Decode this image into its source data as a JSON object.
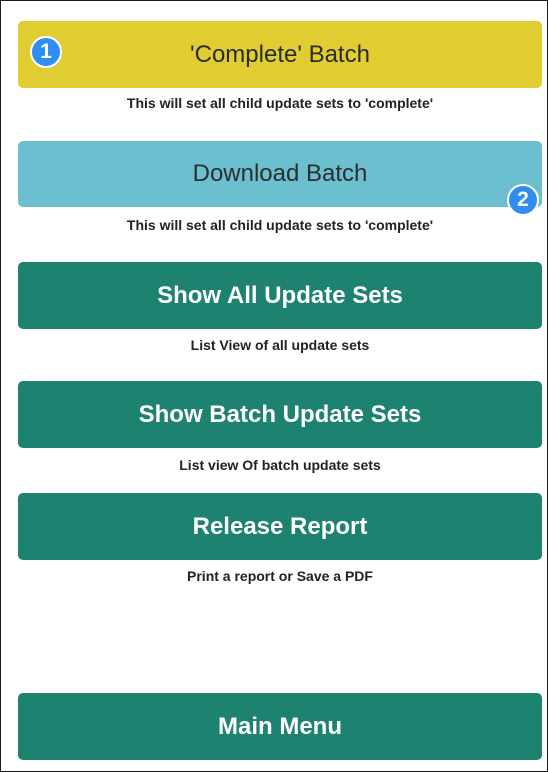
{
  "buttons": {
    "complete_batch": {
      "label": "'Complete' Batch",
      "description": "This will set all child update sets to 'complete'",
      "badge": "1"
    },
    "download_batch": {
      "label": "Download Batch",
      "description": "This will set all child update sets to 'complete'",
      "badge": "2"
    },
    "show_all_update_sets": {
      "label": "Show All Update Sets",
      "description": "List View of all update sets"
    },
    "show_batch_update_sets": {
      "label": "Show Batch Update Sets",
      "description": "List view Of batch update sets"
    },
    "release_report": {
      "label": "Release Report",
      "description": "Print a report or Save a PDF"
    },
    "main_menu": {
      "label": "Main Menu"
    }
  },
  "colors": {
    "yellow": "#e0cd32",
    "blue": "#6bbfcf",
    "green": "#1e8270",
    "badge": "#2f8ff0"
  }
}
